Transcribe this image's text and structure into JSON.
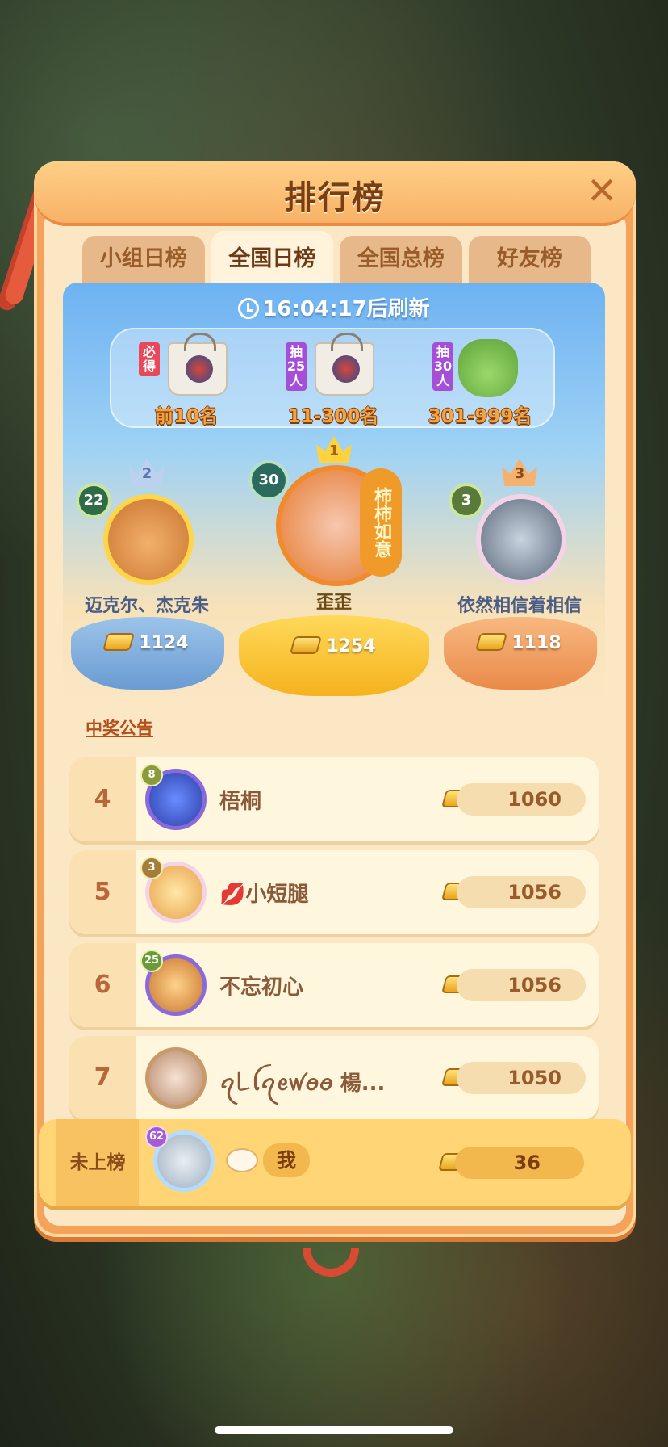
{
  "title": "排行榜",
  "tabs": [
    {
      "label": "小组日榜",
      "active": false
    },
    {
      "label": "全国日榜",
      "active": true
    },
    {
      "label": "全国总榜",
      "active": false
    },
    {
      "label": "好友榜",
      "active": false
    }
  ],
  "refresh_text": "16:04:17后刷新",
  "prizes": [
    {
      "tag": "必得",
      "label": "前10名"
    },
    {
      "tag": "抽25人",
      "label": "11-300名"
    },
    {
      "tag": "抽30人",
      "label": "301-999名"
    }
  ],
  "podium": {
    "first": {
      "rank": "1",
      "level": "30",
      "name": "歪歪",
      "score": "1254",
      "frame_text": "柿柿如意"
    },
    "second": {
      "rank": "2",
      "level": "22",
      "name": "迈克尔、杰克朱",
      "score": "1124"
    },
    "third": {
      "rank": "3",
      "level": "3",
      "name": "依然相信着相信",
      "score": "1118"
    }
  },
  "notice": "中奖公告",
  "rows": [
    {
      "rank": "4",
      "level": "8",
      "name": "梧桐",
      "score": "1060"
    },
    {
      "rank": "5",
      "level": "3",
      "name": "💋小短腿",
      "score": "1056"
    },
    {
      "rank": "6",
      "level": "25",
      "name": "不忘初心",
      "score": "1056"
    },
    {
      "rank": "7",
      "level": "",
      "name": "ꪖ꒒ꪶꪖꫀꪝꪮꪮ 楊...",
      "score": "1050"
    }
  ],
  "me": {
    "rank": "未上榜",
    "level": "62",
    "name": "我",
    "score": "36"
  },
  "icons": {
    "close": "close-icon",
    "clock": "clock-icon",
    "gold": "gold-ingot-icon"
  },
  "colors": {
    "panel": "#f5a25a",
    "accent": "#7b3d12",
    "sky": "#6db2f2"
  }
}
